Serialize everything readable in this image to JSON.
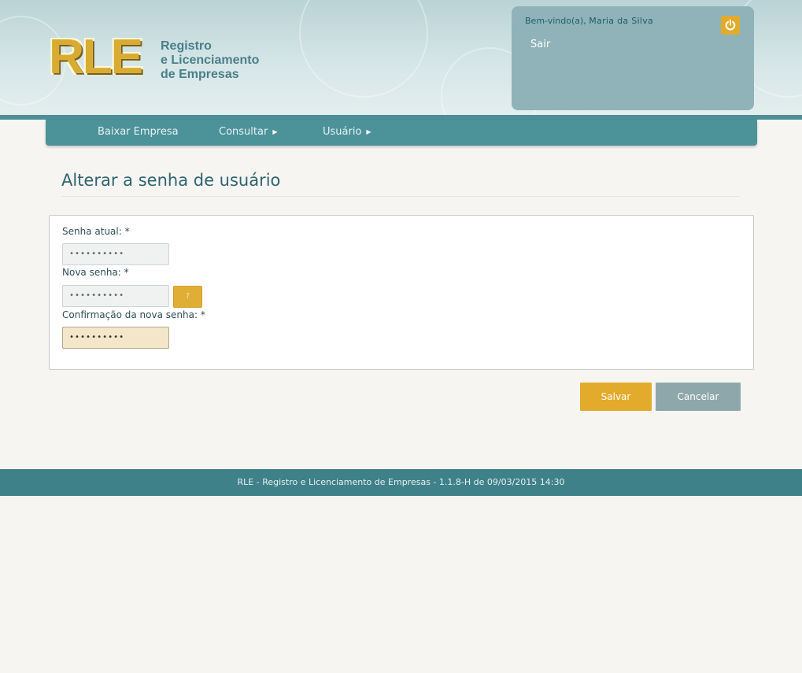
{
  "header": {
    "logo_mark": "RLE",
    "logo_lines": [
      "Registro",
      "e Licenciamento",
      "de Empresas"
    ],
    "welcome_prefix": "Bem-vindo(a),",
    "user_name": "Maria da Silva",
    "logout_label": "Sair",
    "power_icon": "power-icon"
  },
  "nav": {
    "items": [
      {
        "label": "Baixar Empresa",
        "has_submenu": false
      },
      {
        "label": "Consultar",
        "has_submenu": true
      },
      {
        "label": "Usuário",
        "has_submenu": true
      }
    ]
  },
  "page": {
    "title": "Alterar a senha de usuário"
  },
  "form": {
    "current_password": {
      "label": "Senha atual: *",
      "value": "••••••••••"
    },
    "new_password": {
      "label": "Nova senha: *",
      "value": "••••••••••",
      "help_label": "?"
    },
    "confirm_password": {
      "label": "Confirmação da nova senha: *",
      "value": "••••••••••"
    }
  },
  "actions": {
    "save_label": "Salvar",
    "cancel_label": "Cancelar"
  },
  "footer": {
    "text": "RLE - Registro e Licenciamento de Empresas - 1.1.8-H de 09/03/2015 14:30"
  },
  "colors": {
    "accent": "#e3ab2c",
    "nav": "#4c9299",
    "footer": "#3f8189",
    "cancel": "#8ea7ab"
  }
}
